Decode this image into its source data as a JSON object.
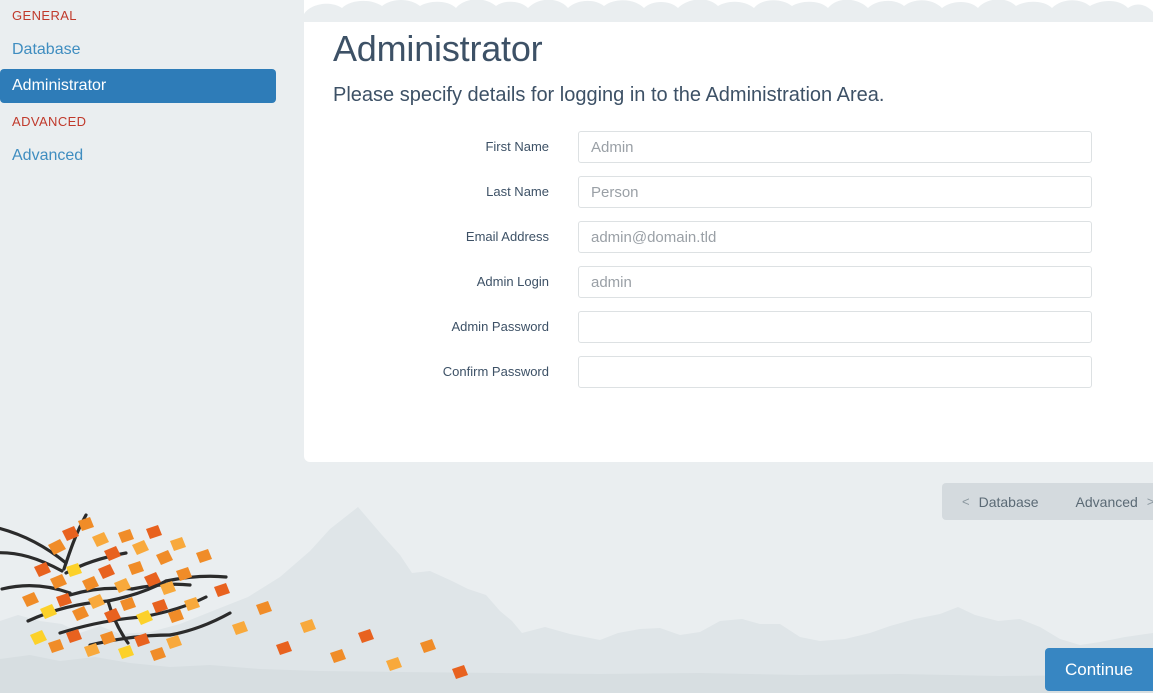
{
  "sidebar": {
    "groups": [
      {
        "heading": "GENERAL",
        "items": [
          {
            "label": "Database",
            "active": false
          },
          {
            "label": "Administrator",
            "active": true
          }
        ]
      },
      {
        "heading": "ADVANCED",
        "items": [
          {
            "label": "Advanced",
            "active": false
          }
        ]
      }
    ]
  },
  "main": {
    "title": "Administrator",
    "subtitle": "Please specify details for logging in to the Administration Area.",
    "fields": [
      {
        "label": "First Name",
        "value": "",
        "placeholder": "Admin",
        "type": "text"
      },
      {
        "label": "Last Name",
        "value": "",
        "placeholder": "Person",
        "type": "text"
      },
      {
        "label": "Email Address",
        "value": "",
        "placeholder": "admin@domain.tld",
        "type": "text"
      },
      {
        "label": "Admin Login",
        "value": "",
        "placeholder": "admin",
        "type": "text"
      },
      {
        "label": "Admin Password",
        "value": "",
        "placeholder": "",
        "type": "password"
      },
      {
        "label": "Confirm Password",
        "value": "",
        "placeholder": "",
        "type": "password"
      }
    ]
  },
  "pager": {
    "prev_arrow": "<",
    "prev_label": "Database",
    "next_label": "Advanced",
    "next_arrow": ">"
  },
  "footer": {
    "continue_label": "Continue"
  },
  "colors": {
    "accent_blue": "#2e7cb8",
    "link_blue": "#3f8dc0",
    "heading_red": "#c0392b",
    "text_slate": "#3d5166",
    "page_bg": "#eaeef0",
    "panel_bg": "#ffffff",
    "pager_bg": "#d4dade",
    "button_blue": "#3786c2",
    "mountain_far": "#dfe5e8",
    "mountain_near": "#d7dee1",
    "leaf_orange": "#f08c28",
    "leaf_deep_orange": "#e8621f",
    "leaf_yellow": "#fcd12a",
    "branch_dark": "#2b2b2b"
  }
}
